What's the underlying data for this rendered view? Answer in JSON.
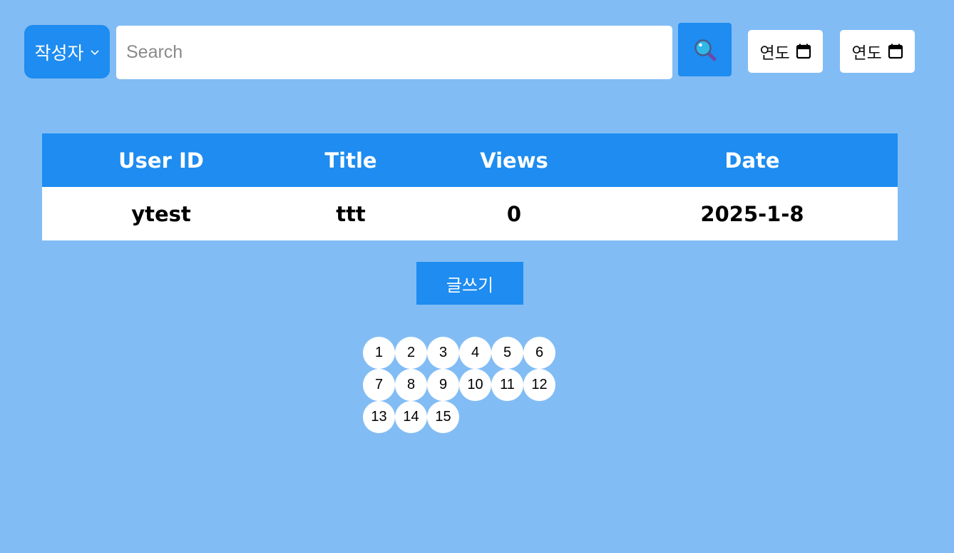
{
  "search": {
    "select_value": "작성자",
    "placeholder": "Search",
    "value": "",
    "start_date_text": "연도",
    "end_date_text": "연도"
  },
  "table": {
    "headers": [
      "User ID",
      "Title",
      "Views",
      "Date"
    ],
    "rows": [
      [
        "ytest",
        "ttt",
        "0",
        "2025-1-8"
      ]
    ]
  },
  "write_button_label": "글쓰기",
  "pagination": {
    "pages": [
      "1",
      "2",
      "3",
      "4",
      "5",
      "6",
      "7",
      "8",
      "9",
      "10",
      "11",
      "12",
      "13",
      "14",
      "15"
    ]
  },
  "colors": {
    "background": "#82bcf4",
    "accent": "#1e8cf0",
    "surface": "#ffffff"
  },
  "icons": {
    "search": "magnifier-icon",
    "select": "chevron-down-icon",
    "date": "calendar-icon"
  }
}
